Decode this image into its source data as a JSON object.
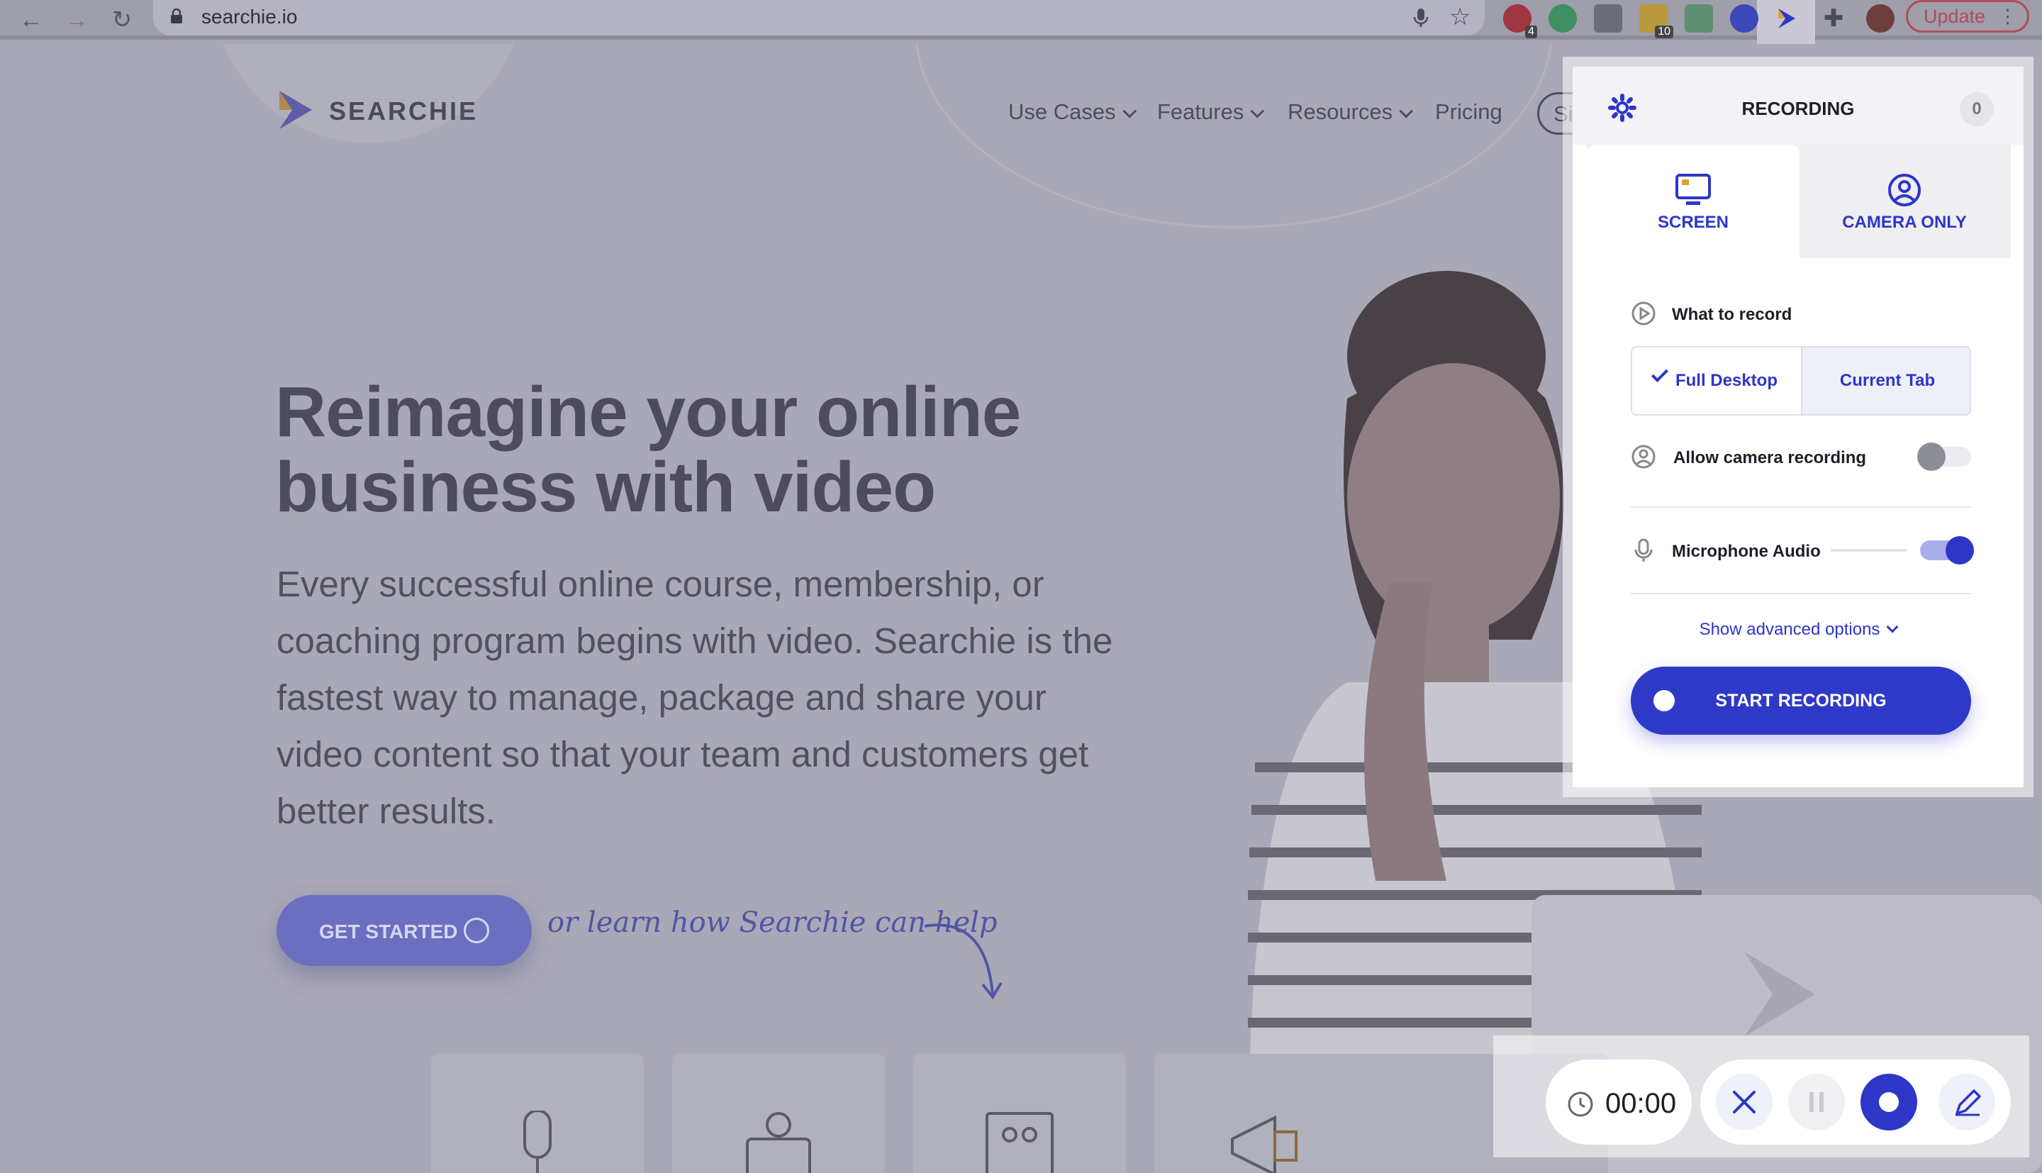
{
  "browser": {
    "url": "searchie.io",
    "update_label": "Update",
    "menu_dots": "⋮",
    "ext_badges": [
      "4",
      "10"
    ]
  },
  "site": {
    "brand": "SEARCHIE",
    "nav": [
      {
        "label": "Use Cases"
      },
      {
        "label": "Features"
      },
      {
        "label": "Resources"
      },
      {
        "label": "Pricing"
      }
    ],
    "signin_label": "Sign",
    "hero_title": "Reimagine your online business with video",
    "hero_subtitle": "Every successful online course, membership, or coaching program begins with video. Searchie is the fastest way to manage, package and share your video content so that your team and customers get better results.",
    "cta_label": "GET STARTED",
    "learn_text": "or learn how Searchie can help"
  },
  "popup": {
    "title": "RECORDING",
    "count": "0",
    "tabs": [
      {
        "label": "SCREEN",
        "active": true
      },
      {
        "label": "CAMERA ONLY",
        "active": false
      }
    ],
    "what_to_record_label": "What to record",
    "record_options": [
      {
        "label": "Full Desktop",
        "selected": true
      },
      {
        "label": "Current Tab",
        "selected": false
      }
    ],
    "camera_label": "Allow camera recording",
    "camera_enabled": false,
    "mic_label": "Microphone Audio",
    "mic_enabled": true,
    "advanced_label": "Show advanced options",
    "start_label": "START RECORDING",
    "accent_color": "#2f39c8"
  },
  "controls": {
    "time": "00:00",
    "buttons": [
      "close-icon",
      "pause-icon",
      "record-icon",
      "pen-icon"
    ]
  }
}
